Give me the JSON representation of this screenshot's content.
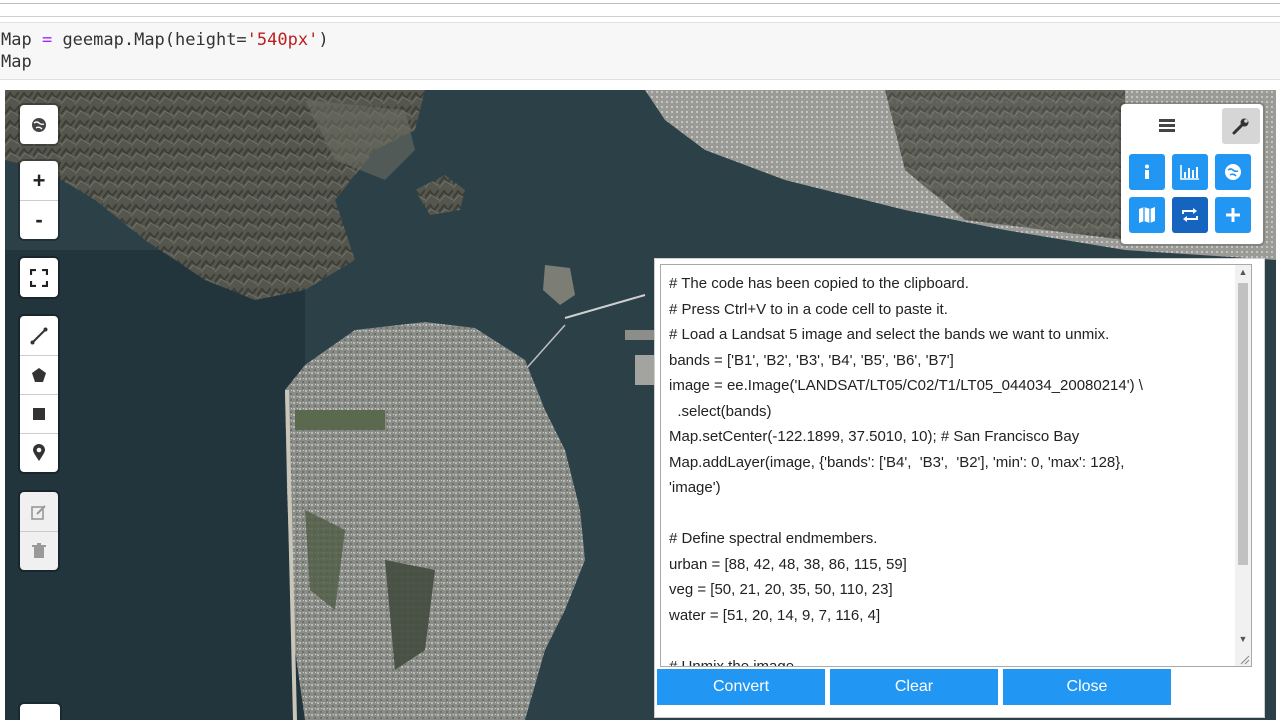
{
  "notebook": {
    "cell_line1": {
      "var": "Map",
      "op": " = ",
      "call": "geemap.Map(height=",
      "str": "'540px'",
      "close": ")"
    },
    "cell_line2": "Map"
  },
  "map_controls": {
    "zoom_in": "+",
    "zoom_out": "-"
  },
  "toolbar": {
    "tabs": [
      "layers-icon",
      "wrench-icon"
    ],
    "buttons": [
      "info-icon",
      "bar-chart-icon",
      "globe-icon",
      "map-icon",
      "convert-icon",
      "plus-icon"
    ],
    "active_button": "convert-icon",
    "accent_color": "#2196f3"
  },
  "code_panel": {
    "lines": [
      "# The code has been copied to the clipboard.",
      "# Press Ctrl+V to in a code cell to paste it.",
      "# Load a Landsat 5 image and select the bands we want to unmix.",
      "bands = ['B1', 'B2', 'B3', 'B4', 'B5', 'B6', 'B7']",
      "image = ee.Image('LANDSAT/LT05/C02/T1/LT05_044034_20080214') \\",
      "  .select(bands)",
      "Map.setCenter(-122.1899, 37.5010, 10); # San Francisco Bay",
      "Map.addLayer(image, {'bands': ['B4',  'B3',  'B2'], 'min': 0, 'max': 128},",
      "'image')",
      "",
      "# Define spectral endmembers.",
      "urban = [88, 42, 48, 38, 86, 115, 59]",
      "veg = [50, 21, 20, 35, 50, 110, 23]",
      "water = [51, 20, 14, 9, 7, 116, 4]",
      "",
      "# Unmix the image."
    ],
    "buttons": {
      "convert": "Convert",
      "clear": "Clear",
      "close": "Close"
    }
  }
}
